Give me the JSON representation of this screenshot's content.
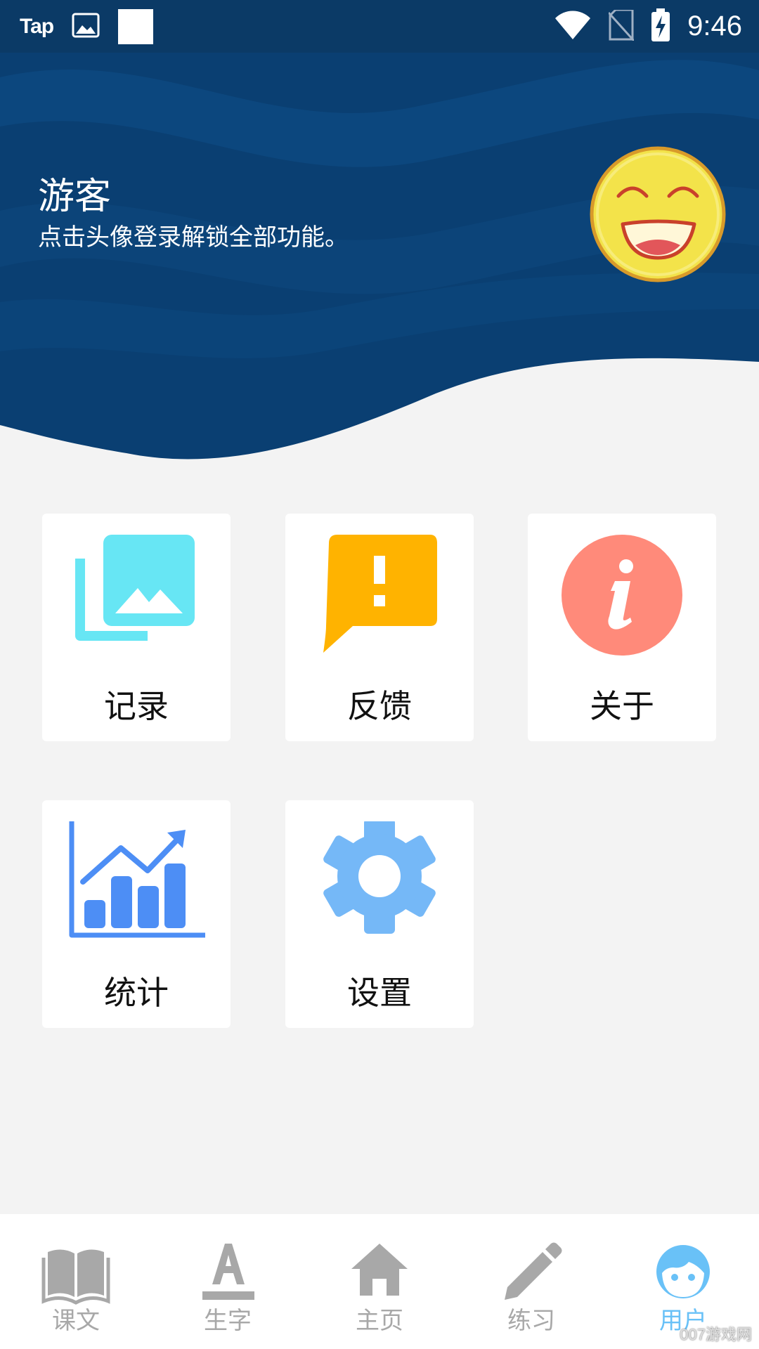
{
  "status_bar": {
    "carrier_label": "Tap",
    "time": "9:46"
  },
  "profile": {
    "name": "游客",
    "hint": "点击头像登录解锁全部功能。"
  },
  "grid": {
    "items": [
      {
        "label": "记录",
        "icon": "photo-library-icon"
      },
      {
        "label": "反馈",
        "icon": "feedback-icon"
      },
      {
        "label": "关于",
        "icon": "info-icon"
      },
      {
        "label": "统计",
        "icon": "stats-chart-icon"
      },
      {
        "label": "设置",
        "icon": "gear-icon"
      }
    ]
  },
  "bottom_nav": {
    "items": [
      {
        "label": "课文",
        "icon": "book-icon",
        "active": false
      },
      {
        "label": "生字",
        "icon": "letter-a-icon",
        "active": false
      },
      {
        "label": "主页",
        "icon": "home-icon",
        "active": false
      },
      {
        "label": "练习",
        "icon": "pencil-icon",
        "active": false
      },
      {
        "label": "用户",
        "icon": "user-face-icon",
        "active": true
      }
    ]
  },
  "watermark": "007游戏网",
  "colors": {
    "header_dark": "#0b3a66",
    "header_wave": "#0d4c84",
    "page_bg": "#f3f3f3",
    "records_cyan": "#67e6f4",
    "feedback_amber": "#ffb300",
    "about_salmon": "#ff8a7a",
    "stats_blue": "#4d8ef5",
    "settings_blue": "#75b8f7",
    "nav_inactive": "#a8a8a8",
    "nav_active": "#69c1f7"
  }
}
